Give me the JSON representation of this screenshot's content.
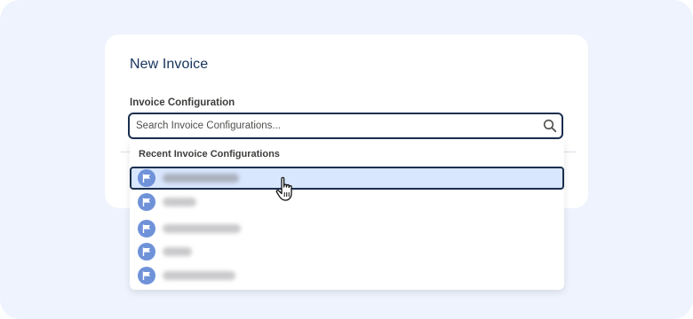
{
  "form": {
    "title": "New Invoice",
    "field_label": "Invoice Configuration",
    "search_placeholder": "Search Invoice Configurations...",
    "search_value": ""
  },
  "dropdown": {
    "header": "Recent Invoice Configurations",
    "selected_index": 0,
    "items": [
      {
        "label": "",
        "icon": "flag-icon"
      },
      {
        "label": "",
        "icon": "flag-icon"
      },
      {
        "label": "",
        "icon": "flag-icon"
      },
      {
        "label": "",
        "icon": "flag-icon"
      },
      {
        "label": "",
        "icon": "flag-icon"
      }
    ]
  },
  "colors": {
    "background": "#eef3fd",
    "accent_border": "#1b2f4e",
    "selected_row": "#d8e6fe",
    "icon_badge": "#6f92d8",
    "title": "#16325c"
  }
}
